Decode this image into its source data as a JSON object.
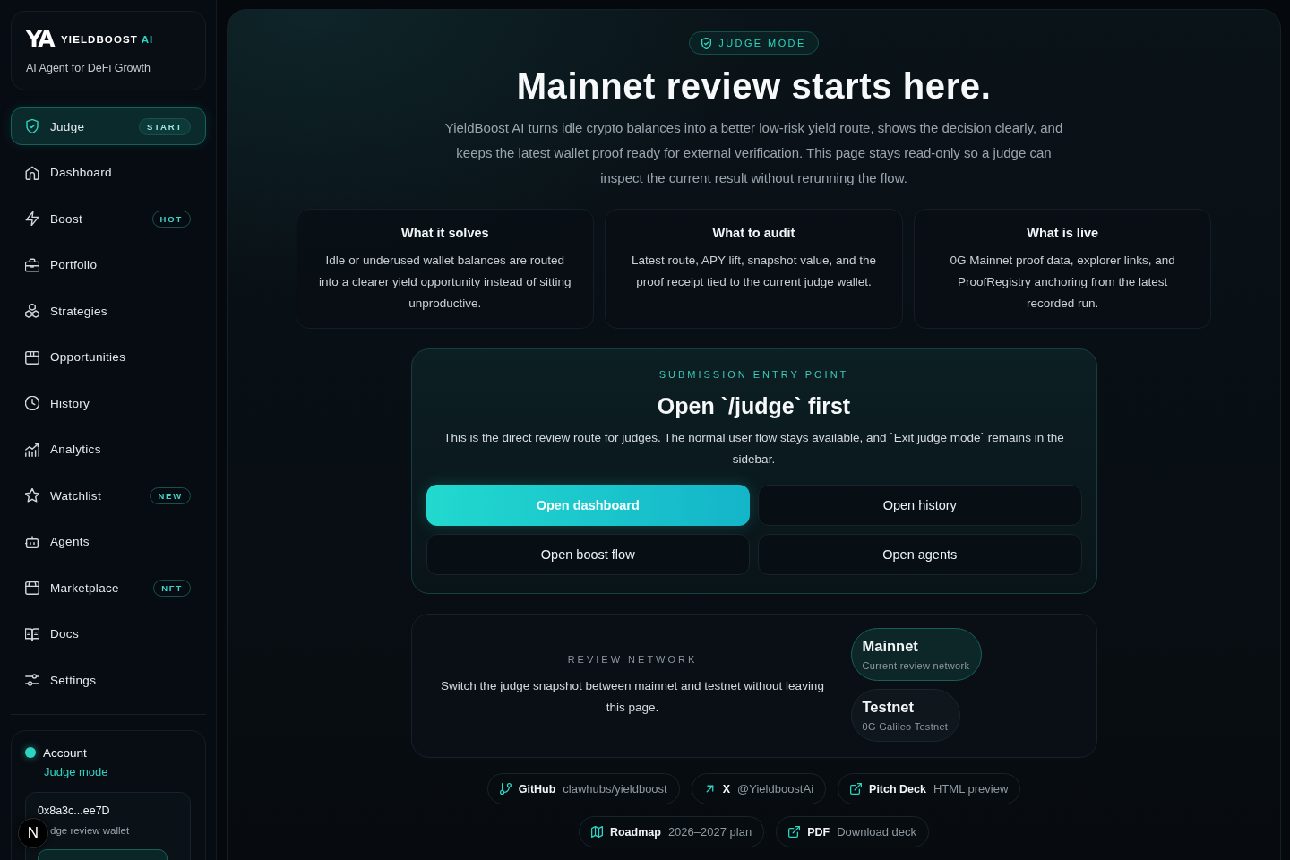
{
  "sidebar": {
    "brand": {
      "mark": "YA",
      "name": "YIELDBOOST",
      "suffix": "AI",
      "tagline": "AI Agent for DeFi Growth"
    },
    "nav": [
      {
        "label": "Judge",
        "selected": true,
        "badge": "START"
      },
      {
        "label": "Dashboard",
        "selected": false
      },
      {
        "label": "Boost",
        "selected": false,
        "badge": "HOT"
      },
      {
        "label": "Portfolio",
        "selected": false
      },
      {
        "label": "Strategies",
        "selected": false
      },
      {
        "label": "Opportunities",
        "selected": false
      },
      {
        "label": "History",
        "selected": false
      },
      {
        "label": "Analytics",
        "selected": false
      },
      {
        "label": "Watchlist",
        "selected": false,
        "badge": "NEW"
      },
      {
        "label": "Agents",
        "selected": false
      },
      {
        "label": "Marketplace",
        "selected": false,
        "badge": "NFT"
      },
      {
        "label": "Docs",
        "selected": false
      },
      {
        "label": "Settings",
        "selected": false
      }
    ],
    "account": {
      "title": "Account",
      "connected": true,
      "mode": "Judge mode",
      "wallet": {
        "address": "0x8a3c...ee7D",
        "label": "dge review wallet"
      }
    }
  },
  "dev_indicator": {
    "label": "N"
  },
  "main": {
    "badge": "JUDGE MODE",
    "title": "Mainnet review starts here.",
    "intro": "YieldBoost AI turns idle crypto balances into a better low-risk yield route, shows the decision clearly, and keeps the latest wallet proof ready for external verification. This page stays read-only so a judge can inspect the current result without rerunning the flow.",
    "info_cards": [
      {
        "title": "What it solves",
        "body": "Idle or underused wallet balances are routed into a clearer yield opportunity instead of sitting unproductive."
      },
      {
        "title": "What to audit",
        "body": "Latest route, APY lift, snapshot value, and the proof receipt tied to the current judge wallet."
      },
      {
        "title": "What is live",
        "body": "0G Mainnet proof data, explorer links, and ProofRegistry anchoring from the latest recorded run."
      }
    ],
    "entry": {
      "eyebrow": "SUBMISSION ENTRY POINT",
      "title": "Open `/judge` first",
      "body": "This is the direct review route for judges. The normal user flow stays available, and `Exit judge mode` remains in the sidebar.",
      "buttons": [
        {
          "label": "Open dashboard",
          "kind": "primary"
        },
        {
          "label": "Open history",
          "kind": "secondary"
        },
        {
          "label": "Open boost flow",
          "kind": "secondary"
        },
        {
          "label": "Open agents",
          "kind": "secondary"
        }
      ]
    },
    "network": {
      "eyebrow": "REVIEW NETWORK",
      "body": "Switch the judge snapshot between mainnet and testnet without leaving this page.",
      "options": [
        {
          "name": "Mainnet",
          "detail": "Current review network",
          "selected": true
        },
        {
          "name": "Testnet",
          "detail": "0G Galileo Testnet",
          "selected": false
        }
      ]
    },
    "link_rows": [
      [
        {
          "label": "GitHub",
          "detail": "clawhubs/yieldboost"
        },
        {
          "label": "X",
          "detail": "@YieldboostAi"
        },
        {
          "label": "Pitch Deck",
          "detail": "HTML preview"
        }
      ],
      [
        {
          "label": "Roadmap",
          "detail": "2026–2027 plan"
        },
        {
          "label": "PDF",
          "detail": "Download deck"
        }
      ]
    ]
  }
}
